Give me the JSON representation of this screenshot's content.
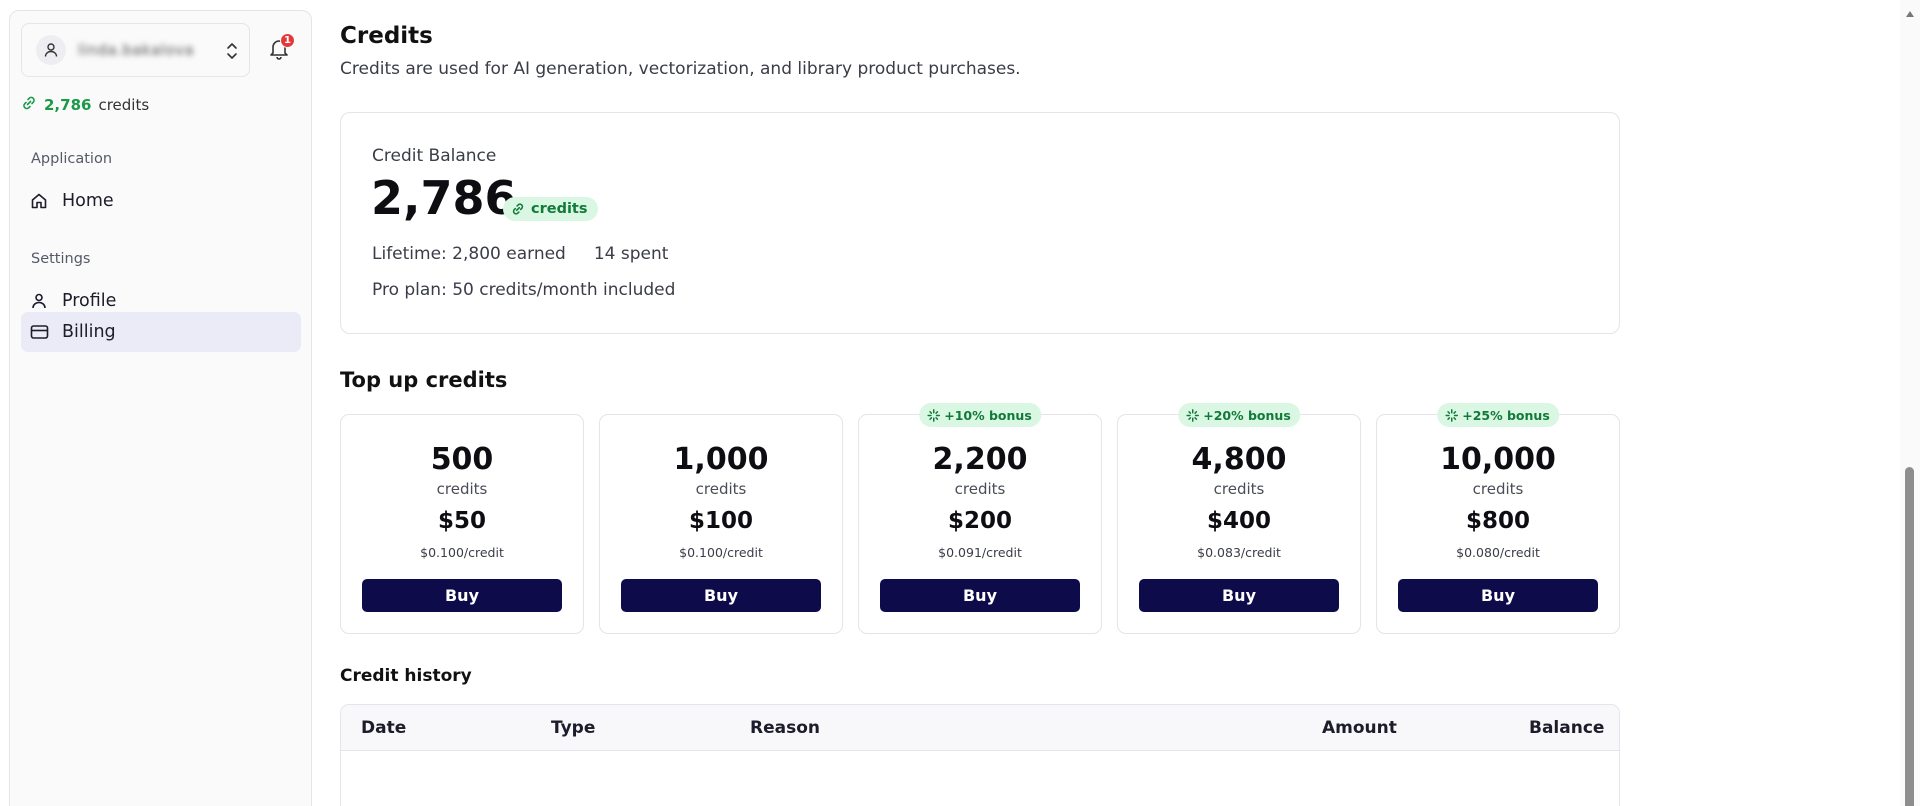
{
  "sidebar": {
    "user_name": "linda.bakalova",
    "notification_count": "1",
    "credits_value": "2,786",
    "credits_label": "credits",
    "sections": [
      {
        "label": "Application"
      },
      {
        "label": "Settings"
      }
    ],
    "items": [
      {
        "label": "Home",
        "icon": "home-icon"
      },
      {
        "label": "Profile",
        "icon": "user-icon"
      },
      {
        "label": "Billing",
        "icon": "credit-card-icon",
        "active": true
      }
    ]
  },
  "page": {
    "title": "Credits",
    "subtitle": "Credits are used for AI generation, vectorization, and library product purchases."
  },
  "balance": {
    "label": "Credit Balance",
    "value": "2,786",
    "unit": "credits",
    "lifetime_earned": "Lifetime: 2,800 earned",
    "lifetime_spent": "14 spent",
    "plan_note": "Pro plan: 50 credits/month included"
  },
  "topup": {
    "title": "Top up credits",
    "packages": [
      {
        "amount": "500",
        "unit": "credits",
        "price": "$50",
        "per_credit": "$0.100/credit",
        "bonus": "",
        "button": "Buy"
      },
      {
        "amount": "1,000",
        "unit": "credits",
        "price": "$100",
        "per_credit": "$0.100/credit",
        "bonus": "",
        "button": "Buy"
      },
      {
        "amount": "2,200",
        "unit": "credits",
        "price": "$200",
        "per_credit": "$0.091/credit",
        "bonus": "+10% bonus",
        "button": "Buy"
      },
      {
        "amount": "4,800",
        "unit": "credits",
        "price": "$400",
        "per_credit": "$0.083/credit",
        "bonus": "+20% bonus",
        "button": "Buy"
      },
      {
        "amount": "10,000",
        "unit": "credits",
        "price": "$800",
        "per_credit": "$0.080/credit",
        "bonus": "+25% bonus",
        "button": "Buy"
      }
    ]
  },
  "history": {
    "title": "Credit history",
    "columns": [
      "Date",
      "Type",
      "Reason",
      "Amount",
      "Balance"
    ]
  },
  "colors": {
    "accent_green": "#1a9a47",
    "bonus_bg": "#d9f7e3",
    "button_navy": "#0e0b4a",
    "active_nav_bg": "#ebebf8",
    "badge_red": "#e5383b"
  }
}
